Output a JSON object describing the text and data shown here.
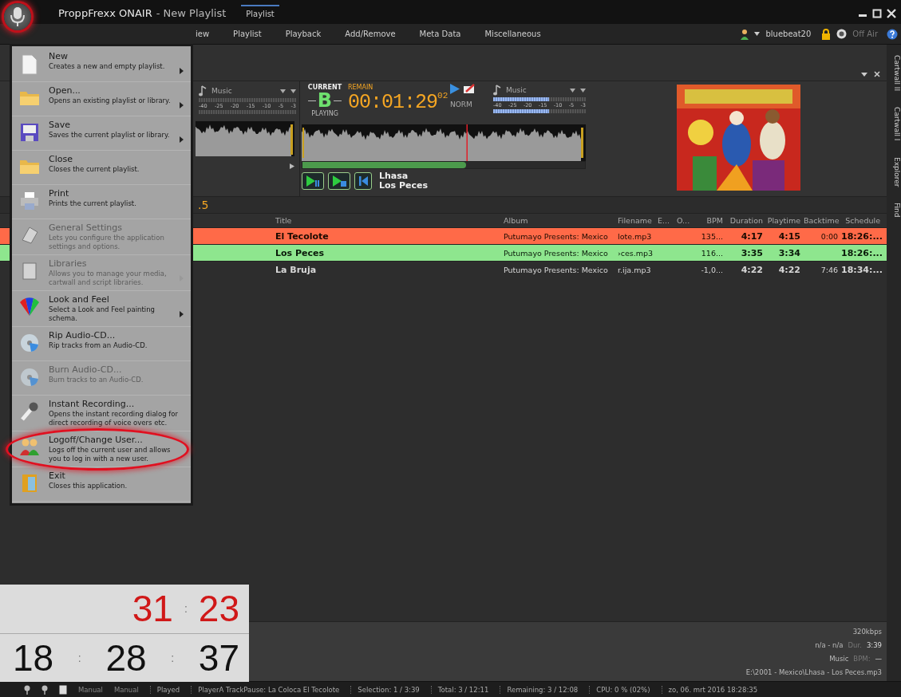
{
  "window": {
    "app_name": "ProppFrexx ONAIR",
    "title": "- New Playlist",
    "tab": "Playlist"
  },
  "menu_bar": [
    "iew",
    "Playlist",
    "Playback",
    "Add/Remove",
    "Meta Data",
    "Miscellaneous"
  ],
  "user": {
    "name": "bluebeat20",
    "air_status": "Off Air"
  },
  "app_menu": {
    "items": [
      {
        "label": "New",
        "description": "Creates a new and empty playlist.",
        "disabled": false,
        "submenu": true,
        "circled": false
      },
      {
        "label": "Open...",
        "description": "Opens an existing playlist or library.",
        "disabled": false,
        "submenu": true,
        "circled": false
      },
      {
        "label": "Save",
        "description": "Saves the current playlist or library.",
        "disabled": false,
        "submenu": true,
        "circled": false
      },
      {
        "label": "Close",
        "description": "Closes the current playlist.",
        "disabled": false,
        "submenu": false,
        "circled": false
      },
      {
        "label": "Print",
        "description": "Prints the current playlist.",
        "disabled": false,
        "submenu": false,
        "circled": false
      },
      {
        "label": "General Settings",
        "description": "Lets you configure the application settings and options.",
        "disabled": true,
        "submenu": false,
        "circled": false
      },
      {
        "label": "Libraries",
        "description": "Allows you to manage your media, cartwall and script libraries.",
        "disabled": true,
        "submenu": true,
        "circled": false
      },
      {
        "label": "Look and Feel",
        "description": "Select a Look and Feel painting schema.",
        "disabled": false,
        "submenu": true,
        "circled": false
      },
      {
        "label": "Rip Audio-CD...",
        "description": "Rip tracks from an Audio-CD.",
        "disabled": false,
        "submenu": false,
        "circled": false
      },
      {
        "label": "Burn Audio-CD...",
        "description": "Burn tracks to an Audio-CD.",
        "disabled": true,
        "submenu": false,
        "circled": false
      },
      {
        "label": "Instant Recording...",
        "description": "Opens the instant recording dialog for direct recording of voice overs etc.",
        "disabled": false,
        "submenu": false,
        "circled": false
      },
      {
        "label": "Logoff/Change User...",
        "description": "Logs off the current user and allows you to log in with a new user.",
        "disabled": false,
        "submenu": false,
        "circled": true
      },
      {
        "label": "Exit",
        "description": "Closes this application.",
        "disabled": false,
        "submenu": false,
        "circled": false
      }
    ]
  },
  "deck_a": {
    "type": "Music",
    "scale": [
      "-40",
      "-25",
      "-20",
      "-15",
      "-10",
      "-5",
      "-3"
    ]
  },
  "deck_b": {
    "current_label": "CURRENT",
    "letter": "B",
    "state": "PLAYING",
    "remain_label": "REMAIN",
    "remain": "00:01:29",
    "remain_fraction": "02",
    "mode": "NORM",
    "type": "Music",
    "scale": [
      "-40",
      "-25",
      "-20",
      "-15",
      "-10",
      "-5",
      "-3"
    ],
    "meter": {
      "level": 0.6
    },
    "position": {
      "level": 0.58
    },
    "artist": "Lhasa",
    "title": "Los Peces"
  },
  "info_value": ".5",
  "table": {
    "columns": [
      "Title",
      "Album",
      "Filename",
      "E...",
      "O...",
      "BPM",
      "Duration",
      "Playtime",
      "Backtime",
      "Schedule"
    ],
    "rows": [
      {
        "kind": "played",
        "cells": [
          "El Tecolote",
          "Putumayo Presents: Mexico",
          "lote.mp3",
          "",
          "",
          "135...",
          "4:17",
          "4:15",
          "0:00",
          "18:26:..."
        ]
      },
      {
        "kind": "playing",
        "cells": [
          "Los Peces",
          "Putumayo Presents: Mexico",
          "›ces.mp3",
          "",
          "",
          "116...",
          "3:35",
          "3:34",
          "",
          "18:26:..."
        ]
      },
      {
        "kind": "queued",
        "cells": [
          "La Bruja",
          "Putumayo Presents: Mexico",
          "r.ija.mp3",
          "",
          "",
          "-1,0...",
          "4:22",
          "4:22",
          "7:46",
          "18:34:..."
        ]
      }
    ]
  },
  "track_info": {
    "bitrate": "320kbps",
    "range": "n/a - n/a",
    "duration_label": "Dur.",
    "duration": "3:39",
    "category": "Music",
    "bpm_label": "BPM:",
    "bpm": "—",
    "path": "E:\\2001 - Mexico\\Lhasa - Los Peces.mp3"
  },
  "clock": {
    "countdown": [
      "31",
      ":",
      "23"
    ],
    "time": [
      "18",
      ":",
      "28",
      ":",
      "37"
    ]
  },
  "status_bar": {
    "modes": [
      "Manual",
      "Manual"
    ],
    "items": [
      "Played",
      "PlayerA TrackPause: La Coloca  El Tecolote",
      "Selection: 1 / 3:39",
      "Total: 3 / 12:11",
      "Remaining: 3 / 12:08",
      "CPU: 0 % (02%)",
      "zo, 06. mrt 2016 18:28:35"
    ]
  },
  "side_tabs": [
    "Cartwall II",
    "Cartwall I",
    "Explorer",
    "Find"
  ]
}
